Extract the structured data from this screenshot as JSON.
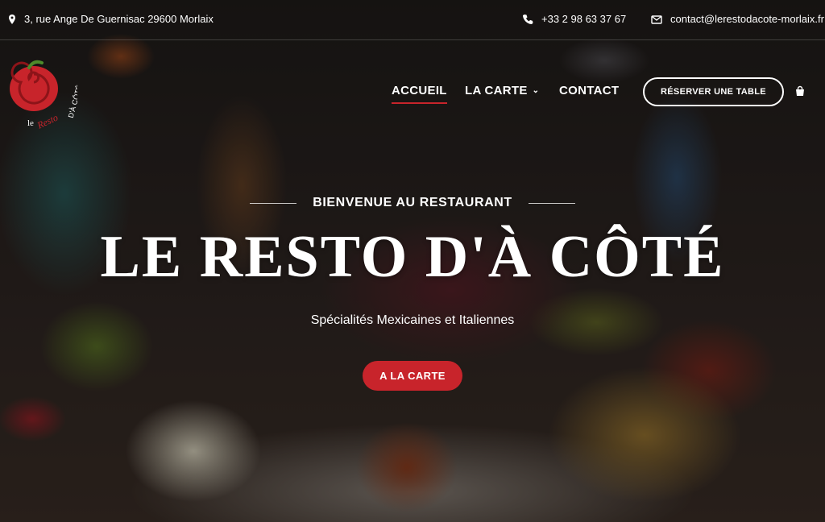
{
  "topbar": {
    "address": "3, rue Ange De Guernisac 29600 Morlaix",
    "phone": "+33 2 98 63 37 67",
    "email": "contact@lerestodacote-morlaix.fr"
  },
  "logo": {
    "text_part1": "le",
    "text_part2": "Resto",
    "text_part3": "D'À CÔTÉ"
  },
  "nav": {
    "items": [
      {
        "label": "ACCUEIL",
        "active": true
      },
      {
        "label": "LA CARTE",
        "has_dropdown": true
      },
      {
        "label": "CONTACT"
      }
    ],
    "reserve_label": "RÉSERVER UNE TABLE"
  },
  "hero": {
    "welcome": "BIENVENUE AU RESTAURANT",
    "title": "LE RESTO D'À CÔTÉ",
    "subtitle": "Spécialités Mexicaines et Italiennes",
    "cta_label": "A LA CARTE"
  },
  "colors": {
    "accent": "#c8242b",
    "text": "#ffffff"
  },
  "icons": {
    "address": "map-pin-icon",
    "phone": "phone-icon",
    "email": "envelope-icon",
    "cart": "shopping-bag-icon",
    "dropdown": "chevron-down-icon"
  }
}
